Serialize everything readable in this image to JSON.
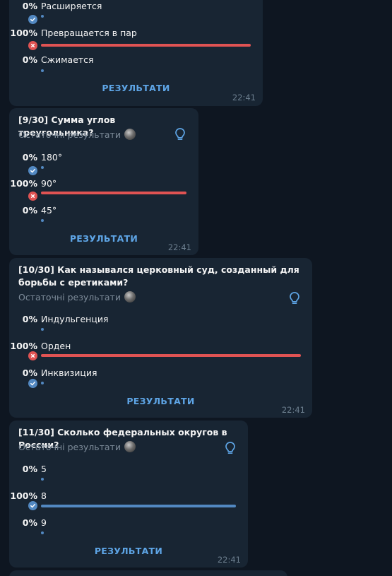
{
  "colors": {
    "background": "#0e1621",
    "bubble": "#182533",
    "accent": "#5288c1",
    "link": "#5ea5e6",
    "wrong": "#e05353"
  },
  "polls": [
    {
      "question": "",
      "subtitle": "",
      "options": [
        {
          "percent": "0%",
          "text": "Расширяется",
          "status": "correct",
          "share": 0
        },
        {
          "percent": "100%",
          "text": "Превращается в пар",
          "status": "wrong",
          "share": 1
        },
        {
          "percent": "0%",
          "text": "Сжимается",
          "status": "none",
          "share": 0
        }
      ],
      "results_label": "РЕЗУЛЬТАТИ",
      "time": "22:41"
    },
    {
      "question": "[9/30] Сумма углов треугольника?",
      "subtitle": "Остаточні результати",
      "options": [
        {
          "percent": "0%",
          "text": "180°",
          "status": "correct",
          "share": 0
        },
        {
          "percent": "100%",
          "text": "90°",
          "status": "wrong",
          "share": 1
        },
        {
          "percent": "0%",
          "text": "45°",
          "status": "none",
          "share": 0
        }
      ],
      "results_label": "РЕЗУЛЬТАТИ",
      "time": "22:41"
    },
    {
      "question": "[10/30] Как назывался церковный суд, созданный для борьбы с еретиками?",
      "subtitle": "Остаточні результати",
      "options": [
        {
          "percent": "0%",
          "text": "Индульгенция",
          "status": "none",
          "share": 0
        },
        {
          "percent": "100%",
          "text": "Орден",
          "status": "wrong",
          "share": 1
        },
        {
          "percent": "0%",
          "text": "Инквизиция",
          "status": "correct",
          "share": 0
        }
      ],
      "results_label": "РЕЗУЛЬТАТИ",
      "time": "22:41"
    },
    {
      "question": "[11/30] Сколько федеральных округов в России?",
      "subtitle": "Остаточні результати",
      "options": [
        {
          "percent": "0%",
          "text": "5",
          "status": "none",
          "share": 0
        },
        {
          "percent": "100%",
          "text": "8",
          "status": "correct",
          "share": 1
        },
        {
          "percent": "0%",
          "text": "9",
          "status": "none",
          "share": 0
        }
      ],
      "results_label": "РЕЗУЛЬТАТИ",
      "time": "22:41"
    }
  ]
}
